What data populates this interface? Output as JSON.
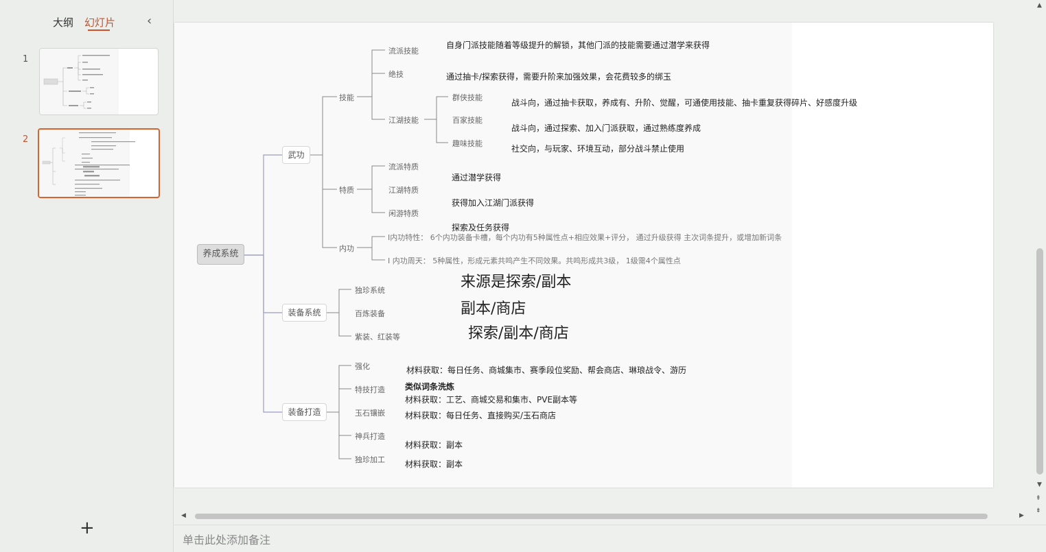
{
  "sidebar": {
    "tabs": [
      "大纲",
      "幻灯片"
    ],
    "slide_numbers": [
      "1",
      "2"
    ],
    "collapse_icon": "chevron-left-icon",
    "add_icon": "plus-icon"
  },
  "mindmap": {
    "root": "养成系统",
    "level1": [
      "武功",
      "装备系统",
      "装备打造"
    ],
    "wugong": {
      "children": [
        "技能",
        "特质",
        "内功"
      ],
      "skills": [
        "流派技能",
        "绝技",
        "江湖技能"
      ],
      "jianghu": [
        "群侠技能",
        "百家技能",
        "趣味技能"
      ],
      "traits": [
        "流派特质",
        "江湖特质",
        "闲游特质"
      ]
    },
    "equip": [
      "独珍系统",
      "百炼装备",
      "紫装、红装等"
    ],
    "forge": [
      "强化",
      "特技打造",
      "玉石镶嵌",
      "神兵打造",
      "独珍加工"
    ]
  },
  "notes": {
    "n1": "自身门派技能随着等级提升的解锁，其他门派的技能需要通过潜学来获得",
    "n2": "通过抽卡/探索获得，需要升阶来加强效果，会花费较多的绑玉",
    "n3": "战斗向，通过抽卡获取，养成有、升阶、觉醒，可通使用技能、抽卡重复获得碎片、好感度升级",
    "n4": "战斗向，通过探索、加入门派获取，通过熟练度养成",
    "n5": "社交向，与玩家、环境互动，部分战斗禁止使用",
    "n6": "通过潜学获得",
    "n7": "获得加入江湖门派获得",
    "n8": "探索及任务获得",
    "n9": "I内功特性：  6个内功装备卡槽，每个内功有5种属性点+相应效果+评分，  通过升级获得 主次词条提升，或增加新词条",
    "n10": "I 内功周天：  5种属性，形成元素共鸣产生不同效果。共鸣形成共3级，  1级需4个属性点",
    "n11": "来源是探索/副本",
    "n12": "副本/商店",
    "n13": "探索/副本/商店",
    "n14": "材料获取：每日任务、商城集市、赛季段位奖励、帮会商店、琳琅战令、游历",
    "n15": "类似词条洗炼",
    "n16": "材料获取：工艺、商城交易和集市、PVE副本等",
    "n17": "材料获取：每日任务、直接购买/玉石商店",
    "n18": "材料获取：副本",
    "n19": "材料获取：副本"
  },
  "notes_placeholder": "单击此处添加备注"
}
